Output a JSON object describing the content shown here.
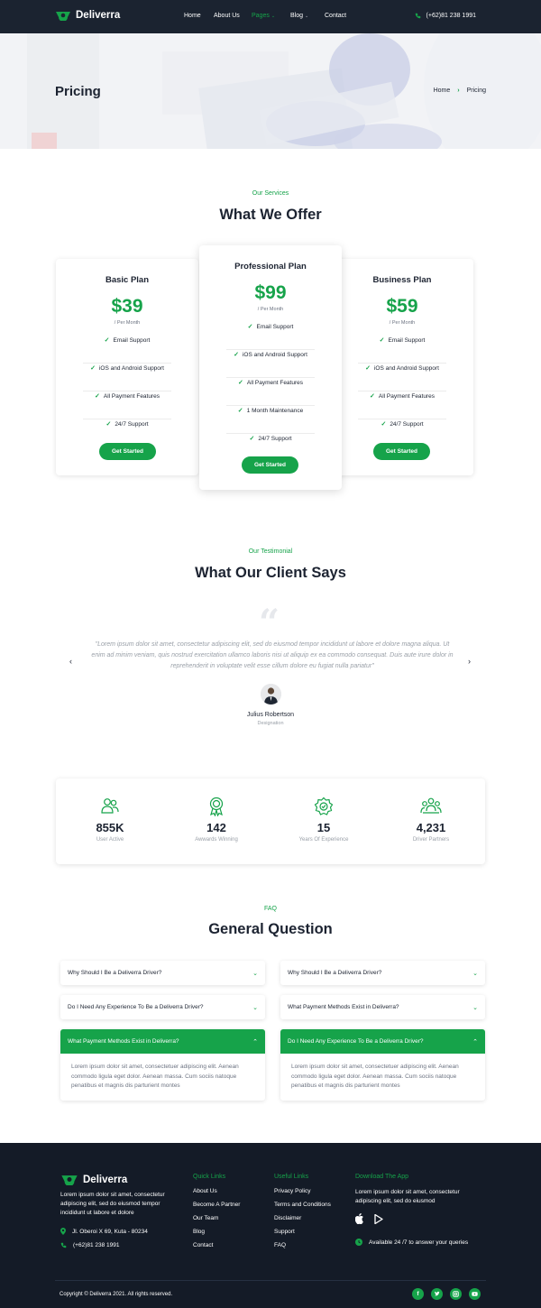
{
  "nav": {
    "brand": "Deliverra",
    "links": [
      "Home",
      "About Us",
      "Pages",
      "Blog",
      "Contact"
    ],
    "active_link": "Pages",
    "phone": "(+62)81 238 1991"
  },
  "hero": {
    "title": "Pricing",
    "breadcrumb_home": "Home",
    "breadcrumb_current": "Pricing"
  },
  "pricing": {
    "eyebrow": "Our Services",
    "title": "What We Offer",
    "period": "/ Per Month",
    "button": "Get Started",
    "plans": [
      {
        "name": "Basic Plan",
        "price": "$39",
        "features": [
          "Email Support",
          "iOS and Android Support",
          "All Payment Features",
          "24/7 Support"
        ]
      },
      {
        "name": "Professional Plan",
        "price": "$99",
        "features": [
          "Email Support",
          "iOS and Android Support",
          "All Payment Features",
          "1 Month Maintenance",
          "24/7 Support"
        ]
      },
      {
        "name": "Business Plan",
        "price": "$59",
        "features": [
          "Email Support",
          "iOS and Android Support",
          "All Payment Features",
          "24/7 Support"
        ]
      }
    ]
  },
  "testimonial": {
    "eyebrow": "Our Testimonial",
    "title": "What Our Client Says",
    "quote": "\"Lorem ipsum dolor sit amet, consectetur adipiscing elit, sed do eiusmod tempor incididunt ut labore et dolore magna aliqua. Ut enim ad minim veniam, quis nostrud exercitation ullamco laboris nisi ut aliquip ex ea commodo consequat. Duis aute irure dolor in reprehenderit in voluptate velit esse cillum dolore eu fugiat nulla pariatur\"",
    "name": "Julius Robertson",
    "role": "Designation"
  },
  "stats": [
    {
      "value": "855K",
      "label": "User Active",
      "icon": "users-icon"
    },
    {
      "value": "142",
      "label": "Awwards Winning",
      "icon": "award-icon"
    },
    {
      "value": "15",
      "label": "Years Of Experience",
      "icon": "badge-icon"
    },
    {
      "value": "4,231",
      "label": "Driver Partners",
      "icon": "team-icon"
    }
  ],
  "faq": {
    "eyebrow": "FAQ",
    "title": "General Question",
    "left": [
      {
        "q": "Why Should I Be a Deliverra Driver?"
      },
      {
        "q": "Do I Need Any Experience To Be a Deliverra Driver?"
      },
      {
        "q": "What Payment Methods Exist in Deliverra?",
        "a": "Lorem ipsum dolor sit amet, consectetuer adipiscing elit. Aenean commodo ligula eget dolor. Aenean massa. Cum sociis natoque penatibus et magnis dis parturient montes"
      }
    ],
    "right": [
      {
        "q": "Why Should I Be a Deliverra Driver?"
      },
      {
        "q": "What Payment Methods Exist in Deliverra?"
      },
      {
        "q": "Do I Need Any Experience To Be a Deliverra Driver?",
        "a": "Lorem ipsum dolor sit amet, consectetuer adipiscing elit. Aenean commodo ligula eget dolor. Aenean massa. Cum sociis natoque penatibus et magnis dis parturient montes"
      }
    ]
  },
  "footer": {
    "brand": "Deliverra",
    "about": "Lorem ipsum dolor sit amet, consectetur adipiscing elit, sed do eiusmod tempor incididunt ut labore et dolore",
    "address": "Jl. Oberoi X 69, Kuta - 80234",
    "phone": "(+62)81 238 1991",
    "quick_title": "Quick Links",
    "quick_links": [
      "About Us",
      "Become A Partner",
      "Our Team",
      "Blog",
      "Contact"
    ],
    "useful_title": "Useful Links",
    "useful_links": [
      "Privacy Policy",
      "Terms and Conditions",
      "Disclaimer",
      "Support",
      "FAQ"
    ],
    "app_title": "Download The App",
    "app_text": "Lorem ipsum dolor sit amet, consectetur adipiscing elit, sed do eiusmod",
    "availability": "Available 24 /7 to answer your queries",
    "copyright": "Copyright © Deliverra 2021. All rights reserved.",
    "socials": [
      "facebook-icon",
      "twitter-icon",
      "instagram-icon",
      "youtube-icon"
    ]
  },
  "colors": {
    "accent": "#16a34a",
    "dark": "#1b2330",
    "footer": "#141b27"
  }
}
